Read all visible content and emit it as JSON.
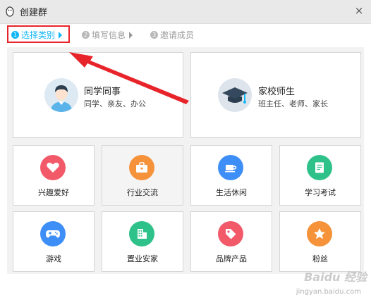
{
  "window": {
    "title": "创建群",
    "close_glyph": "×"
  },
  "steps": [
    {
      "num": "1",
      "label": "选择类别",
      "state": "active"
    },
    {
      "num": "2",
      "label": "填写信息",
      "state": "inactive"
    },
    {
      "num": "3",
      "label": "邀请成员",
      "state": "inactive"
    }
  ],
  "big_cards": [
    {
      "title": "同学同事",
      "subtitle": "同学、亲友、办公",
      "icon": "student-avatar-icon"
    },
    {
      "title": "家校师生",
      "subtitle": "班主任、老师、家长",
      "icon": "graduation-cap-icon"
    }
  ],
  "categories": [
    {
      "label": "兴趣爱好",
      "icon": "heart-icon",
      "color": "#f25a6a"
    },
    {
      "label": "行业交流",
      "icon": "briefcase-icon",
      "color": "#f5923a"
    },
    {
      "label": "生活休闲",
      "icon": "coffee-cup-icon",
      "color": "#3e8ef7"
    },
    {
      "label": "学习考试",
      "icon": "notebook-icon",
      "color": "#2ec28a"
    },
    {
      "label": "游戏",
      "icon": "gamepad-icon",
      "color": "#3e8ef7"
    },
    {
      "label": "置业安家",
      "icon": "building-icon",
      "color": "#2ec28a"
    },
    {
      "label": "品牌产品",
      "icon": "tag-icon",
      "color": "#f25a6a"
    },
    {
      "label": "粉丝",
      "icon": "star-icon",
      "color": "#f5923a"
    }
  ],
  "colors": {
    "accent": "#12b7f5",
    "annotation": "#e8242b"
  },
  "watermark": {
    "text": "Baidu 经验",
    "sub": "jingyan.baidu.com"
  }
}
